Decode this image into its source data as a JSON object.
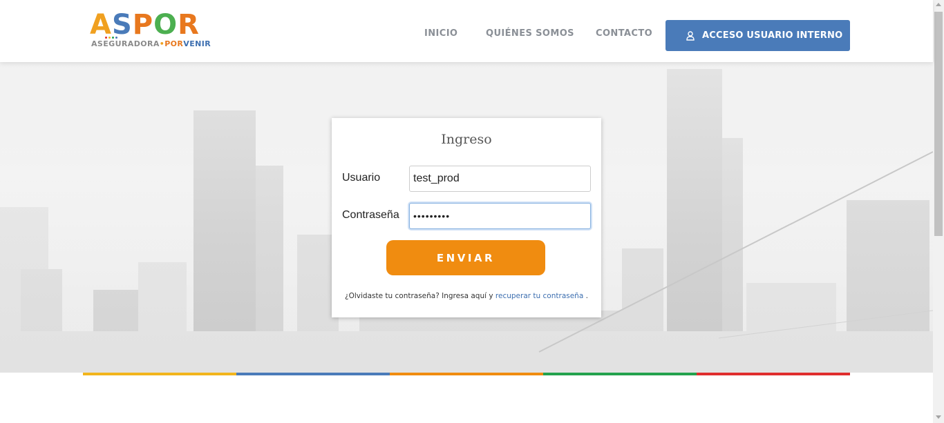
{
  "header": {
    "logo": {
      "letters": [
        "A",
        "S",
        "P",
        "O",
        "R"
      ],
      "letter_colors": [
        "#f0a020",
        "#4a7bb9",
        "#e8781e",
        "#4caf50",
        "#e8781e"
      ],
      "tagline_a": "ASEGURADORA",
      "tagline_dot": "•",
      "tagline_b": "POR",
      "tagline_c": "VENIR"
    },
    "nav": {
      "inicio": "INICIO",
      "quienes": "QUIÉNES SOMOS",
      "contacto": "CONTACTO"
    },
    "access_button": {
      "icon": "user-icon",
      "label": "ACCESO USUARIO INTERNO"
    }
  },
  "login": {
    "title": "Ingreso",
    "username_label": "Usuario",
    "username_value": "test_prod",
    "password_label": "Contraseña",
    "password_value": "•••••••••",
    "submit_label": "ENVIAR",
    "forgot_text": "¿Olvidaste tu contraseña? Ingresa aquí y ",
    "forgot_link": "recuperar tu contraseña",
    "forgot_end": " ."
  },
  "colors": {
    "brand_blue": "#4a7bb9",
    "brand_orange": "#f08c10",
    "stripe": [
      "#f2b51d",
      "#4a7bb9",
      "#f08c10",
      "#23a24d",
      "#e02d2d"
    ]
  }
}
